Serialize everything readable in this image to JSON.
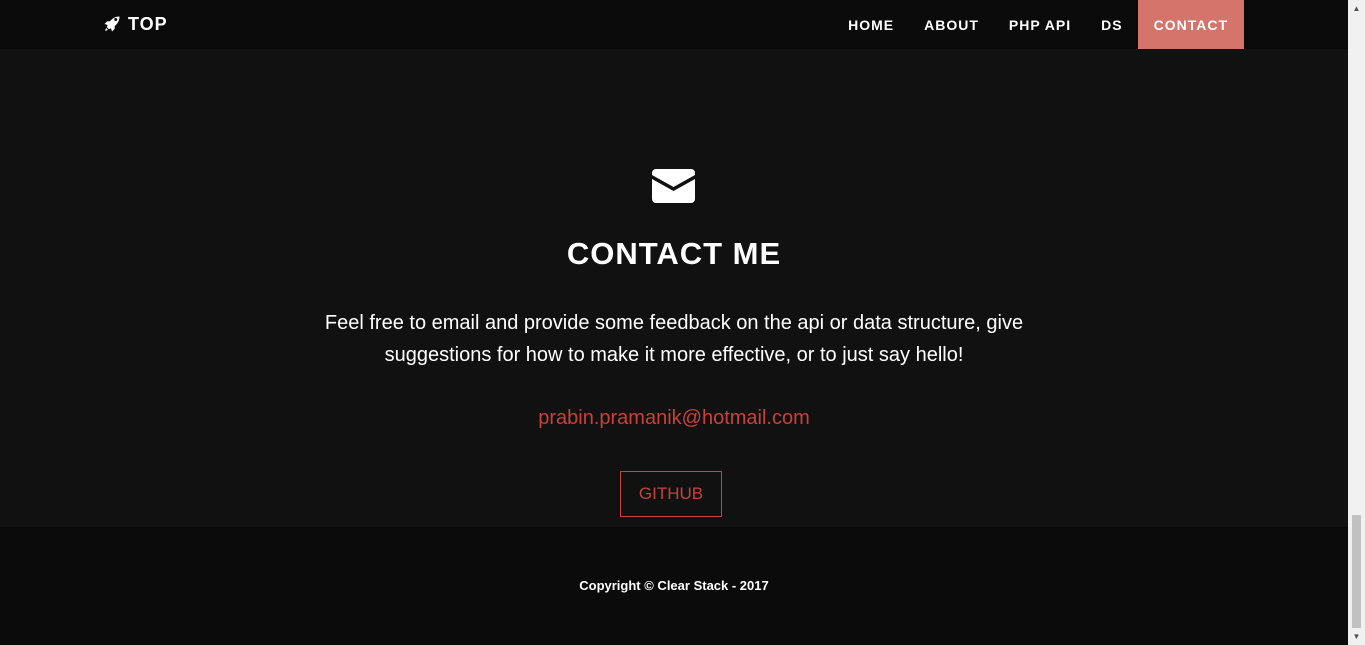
{
  "navbar": {
    "brand_label": "TOP",
    "brand_icon": "rocket-icon",
    "items": [
      {
        "label": "HOME",
        "active": false
      },
      {
        "label": "ABOUT",
        "active": false
      },
      {
        "label": "PHP API",
        "active": false
      },
      {
        "label": "DS",
        "active": false
      },
      {
        "label": "CONTACT",
        "active": true
      }
    ]
  },
  "contact": {
    "icon": "envelope-icon",
    "heading": "CONTACT ME",
    "blurb": "Feel free to email and provide some feedback on the api or data structure, give suggestions for how to make it more effective, or to just say hello!",
    "email": "prabin.pramanik@hotmail.com",
    "github_label": "GITHUB"
  },
  "footer": {
    "copyright": "Copyright © Clear Stack - 2017"
  },
  "colors": {
    "background": "#111111",
    "navbar": "#0b0b0b",
    "accent": "#d4746b",
    "link": "#c9413a"
  }
}
